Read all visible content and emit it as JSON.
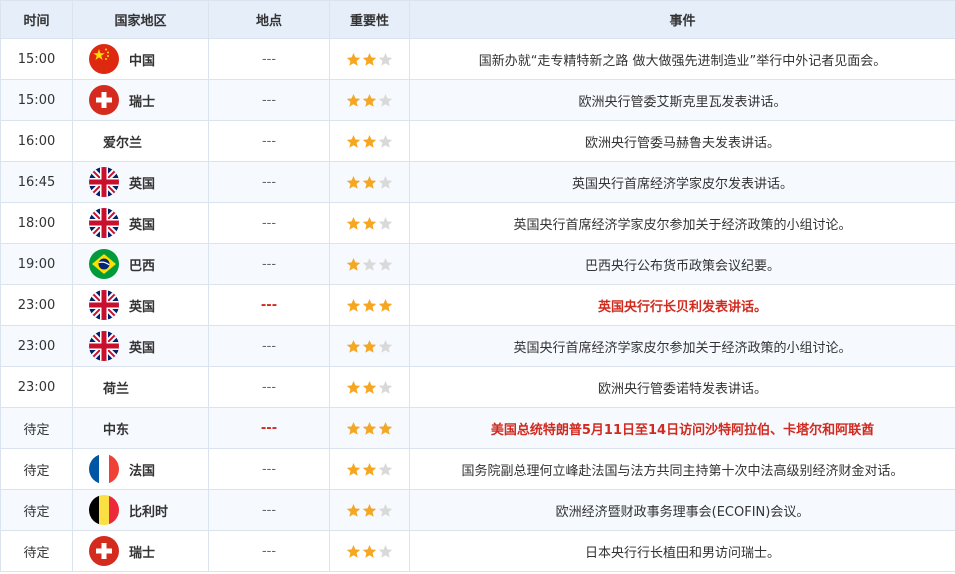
{
  "headers": {
    "time": "时间",
    "country": "国家地区",
    "location": "地点",
    "importance": "重要性",
    "event": "事件"
  },
  "colors": {
    "header_bg": "#e6eef9",
    "border": "#dbe3ef",
    "star_on": "#f5a623",
    "star_off": "#d9d9d9",
    "highlight": "#d12a1f"
  },
  "rows": [
    {
      "time": "15:00",
      "country": "中国",
      "flag": "china-flag-icon",
      "location": "---",
      "stars": 2,
      "event": "国新办就“走专精特新之路 做大做强先进制造业”举行中外记者见面会。",
      "highlight": false
    },
    {
      "time": "15:00",
      "country": "瑞士",
      "flag": "switzerland-flag-icon",
      "location": "---",
      "stars": 2,
      "event": "欧洲央行管委艾斯克里瓦发表讲话。",
      "highlight": false
    },
    {
      "time": "16:00",
      "country": "爱尔兰",
      "flag": "",
      "location": "---",
      "stars": 2,
      "event": "欧洲央行管委马赫鲁夫发表讲话。",
      "highlight": false
    },
    {
      "time": "16:45",
      "country": "英国",
      "flag": "uk-flag-icon",
      "location": "---",
      "stars": 2,
      "event": "英国央行首席经济学家皮尔发表讲话。",
      "highlight": false
    },
    {
      "time": "18:00",
      "country": "英国",
      "flag": "uk-flag-icon",
      "location": "---",
      "stars": 2,
      "event": "英国央行首席经济学家皮尔参加关于经济政策的小组讨论。",
      "highlight": false
    },
    {
      "time": "19:00",
      "country": "巴西",
      "flag": "brazil-flag-icon",
      "location": "---",
      "stars": 1,
      "event": "巴西央行公布货币政策会议纪要。",
      "highlight": false
    },
    {
      "time": "23:00",
      "country": "英国",
      "flag": "uk-flag-icon",
      "location": "---",
      "stars": 3,
      "event": "英国央行行长贝利发表讲话。",
      "highlight": true
    },
    {
      "time": "23:00",
      "country": "英国",
      "flag": "uk-flag-icon",
      "location": "---",
      "stars": 2,
      "event": "英国央行首席经济学家皮尔参加关于经济政策的小组讨论。",
      "highlight": false
    },
    {
      "time": "23:00",
      "country": "荷兰",
      "flag": "",
      "location": "---",
      "stars": 2,
      "event": "欧洲央行管委诺特发表讲话。",
      "highlight": false
    },
    {
      "time": "待定",
      "country": "中东",
      "flag": "",
      "location": "---",
      "stars": 3,
      "event": "美国总统特朗普5月11日至14日访问沙特阿拉伯、卡塔尔和阿联酋",
      "highlight": true
    },
    {
      "time": "待定",
      "country": "法国",
      "flag": "france-flag-icon",
      "location": "---",
      "stars": 2,
      "event": "国务院副总理何立峰赴法国与法方共同主持第十次中法高级别经济财金对话。",
      "highlight": false
    },
    {
      "time": "待定",
      "country": "比利时",
      "flag": "belgium-flag-icon",
      "location": "---",
      "stars": 2,
      "event": "欧洲经济暨财政事务理事会(ECOFIN)会议。",
      "highlight": false
    },
    {
      "time": "待定",
      "country": "瑞士",
      "flag": "switzerland-flag-icon",
      "location": "---",
      "stars": 2,
      "event": "日本央行行长植田和男访问瑞士。",
      "highlight": false
    }
  ]
}
